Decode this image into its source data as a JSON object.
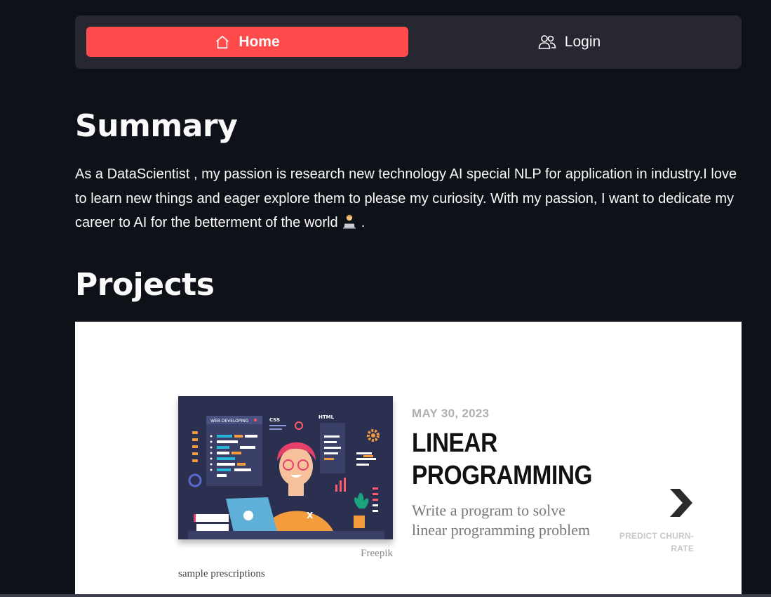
{
  "nav": {
    "home_label": "Home",
    "login_label": "Login",
    "active_color": "#ff4b4b"
  },
  "summary": {
    "heading": "Summary",
    "text_before_emoji": "As a DataScientist , my passion is research new technology AI special NLP for application in industry.I love to learn new things and eager explore them to please my curiosity. With my passion, I want to dedicate my career to AI for the betterment of the world ",
    "emoji": "technologist-emoji",
    "text_after_emoji": " ."
  },
  "projects": {
    "heading": "Projects",
    "card": {
      "image_credit": "Freepik",
      "image_caption": "sample prescriptions",
      "image_label_web": "WEB DEVELOPING",
      "image_label_css": "CSS",
      "image_label_html": "HTML",
      "date": "MAY 30, 2023",
      "title": "LINEAR PROGRAMMING",
      "description": "Write a program to solve linear programming problem",
      "next_label": "PREDICT CHURN-RATE",
      "next_icon": "chevron-right-icon"
    }
  },
  "colors": {
    "background": "#0e1117",
    "navbar": "#262730",
    "card": "#ffffff"
  }
}
